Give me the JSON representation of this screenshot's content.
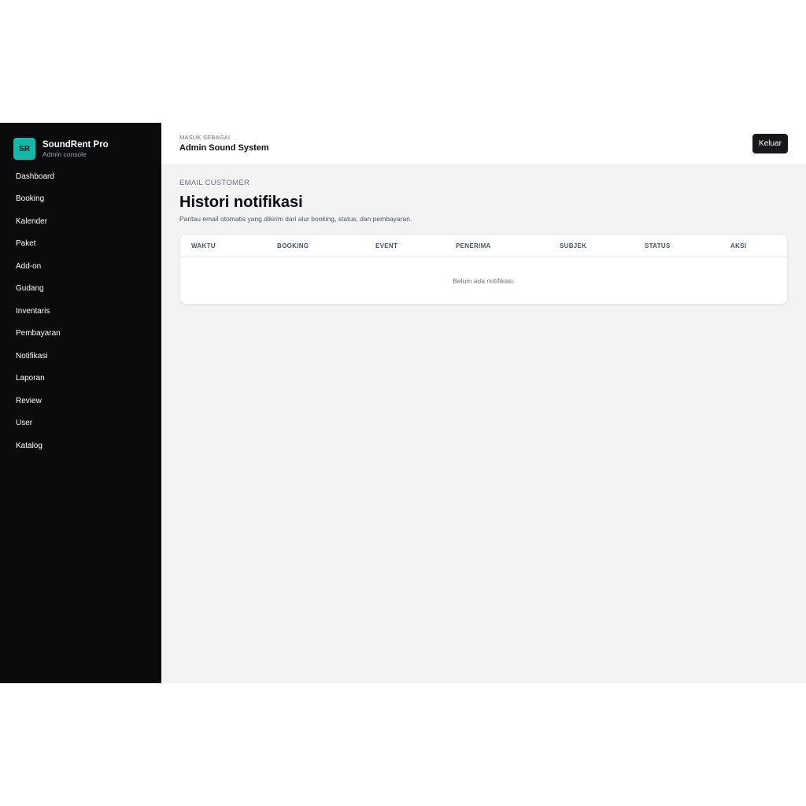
{
  "brand": {
    "logo": "SR",
    "name": "SoundRent Pro",
    "subtitle": "Admin console"
  },
  "sidebar": {
    "items": [
      {
        "label": "Dashboard"
      },
      {
        "label": "Booking"
      },
      {
        "label": "Kalender"
      },
      {
        "label": "Paket"
      },
      {
        "label": "Add-on"
      },
      {
        "label": "Gudang"
      },
      {
        "label": "Inventaris"
      },
      {
        "label": "Pembayaran"
      },
      {
        "label": "Notifikasi"
      },
      {
        "label": "Laporan"
      },
      {
        "label": "Review"
      },
      {
        "label": "User"
      },
      {
        "label": "Katalog"
      }
    ]
  },
  "topbar": {
    "label": "MASUK SEBAGAI",
    "user": "Admin Sound System",
    "logout_label": "Keluar"
  },
  "page": {
    "eyebrow": "EMAIL CUSTOMER",
    "title": "Histori notifikasi",
    "description": "Pantau email otomatis yang dikirim dari alur booking, status, dan pembayaran."
  },
  "table": {
    "columns": [
      "WAKTU",
      "BOOKING",
      "EVENT",
      "PENERIMA",
      "SUBJEK",
      "STATUS",
      "AKSI"
    ],
    "empty_text": "Belum ada notifikasi."
  },
  "colors": {
    "sidebar_bg": "#0b0b0d",
    "accent": "#14b8a6",
    "content_bg": "#f3f3f4",
    "button_bg": "#18181b"
  }
}
